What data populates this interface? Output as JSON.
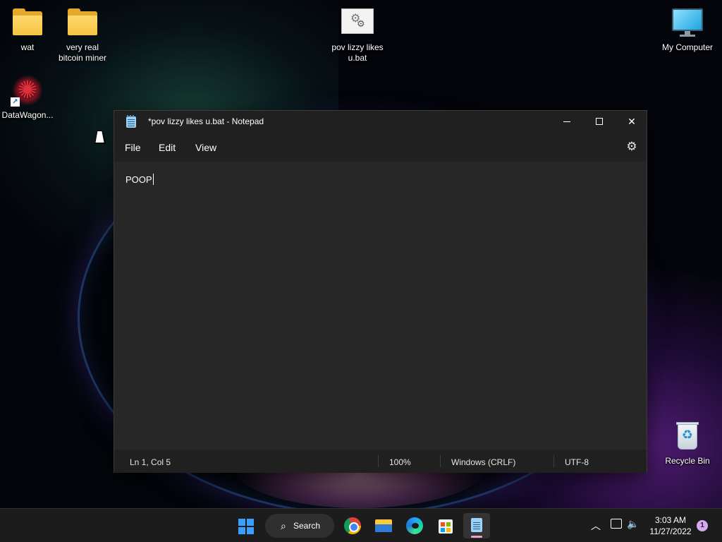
{
  "desktop": {
    "icons": [
      {
        "label": "wat",
        "icon": "folder-icon"
      },
      {
        "label": "very real bitcoin miner",
        "icon": "folder-icon"
      },
      {
        "label": "pov lizzy likes u.bat",
        "icon": "batch-file-icon"
      },
      {
        "label": "My Computer",
        "icon": "monitor-icon"
      },
      {
        "label": "DataWagon...",
        "icon": "datawagon-shortcut-icon"
      },
      {
        "label": "Recycle Bin",
        "icon": "recycle-bin-icon"
      }
    ]
  },
  "notepad": {
    "title": "*pov lizzy likes u.bat - Notepad",
    "menu": {
      "file": "File",
      "edit": "Edit",
      "view": "View"
    },
    "content": "POOP",
    "status": {
      "position": "Ln 1, Col 5",
      "zoom": "100%",
      "line_ending": "Windows (CRLF)",
      "encoding": "UTF-8"
    }
  },
  "taskbar": {
    "search_label": "Search",
    "apps": [
      "start-icon",
      "chrome-icon",
      "file-explorer-icon",
      "edge-icon",
      "store-icon",
      "notepad-icon"
    ],
    "clock_time": "3:03 AM",
    "clock_date": "11/27/2022",
    "notification_count": "1"
  },
  "colors": {
    "accent": "#3aa0ff",
    "window_bg": "#272727",
    "titlebar_bg": "#202020",
    "taskbar_bg": "#1c1c1c"
  }
}
